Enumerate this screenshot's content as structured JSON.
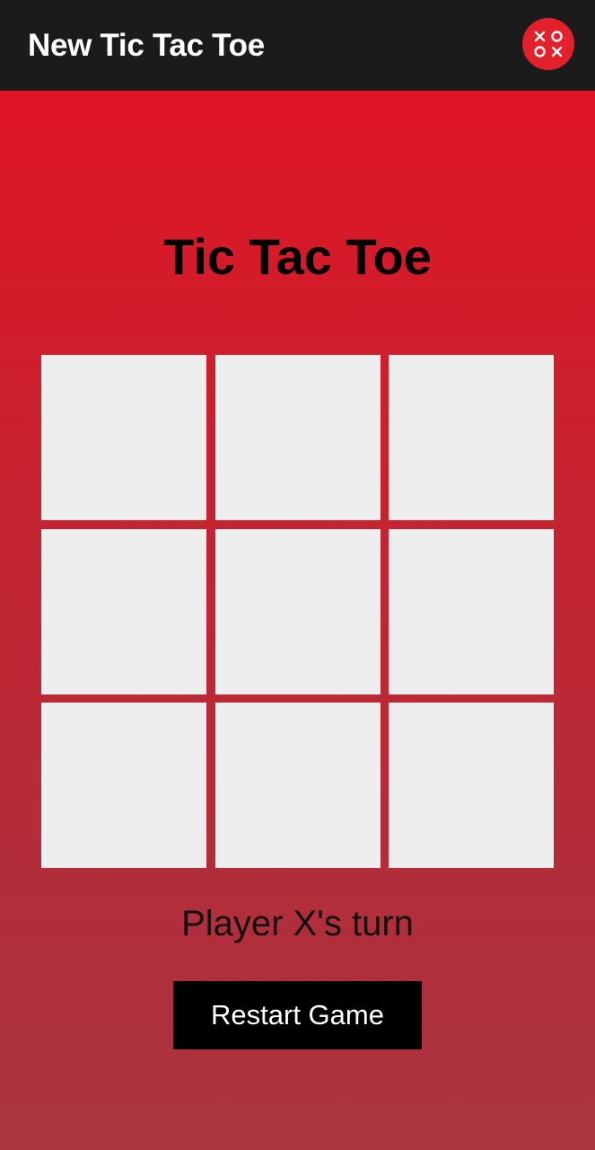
{
  "app_bar": {
    "title": "New Tic Tac Toe",
    "icon": "tic-tac-toe-icon",
    "icon_color": "#e4202b",
    "background": "#1b1b1b"
  },
  "game": {
    "title": "Tic Tac Toe",
    "board": {
      "cells": [
        "",
        "",
        "",
        "",
        "",
        "",
        "",
        "",
        ""
      ]
    },
    "status": "Player X's turn",
    "restart_label": "Restart Game"
  },
  "colors": {
    "gradient_top": "#e01424",
    "gradient_bottom": "#a93540",
    "cell": "#eeeeee",
    "button": "#000000"
  }
}
